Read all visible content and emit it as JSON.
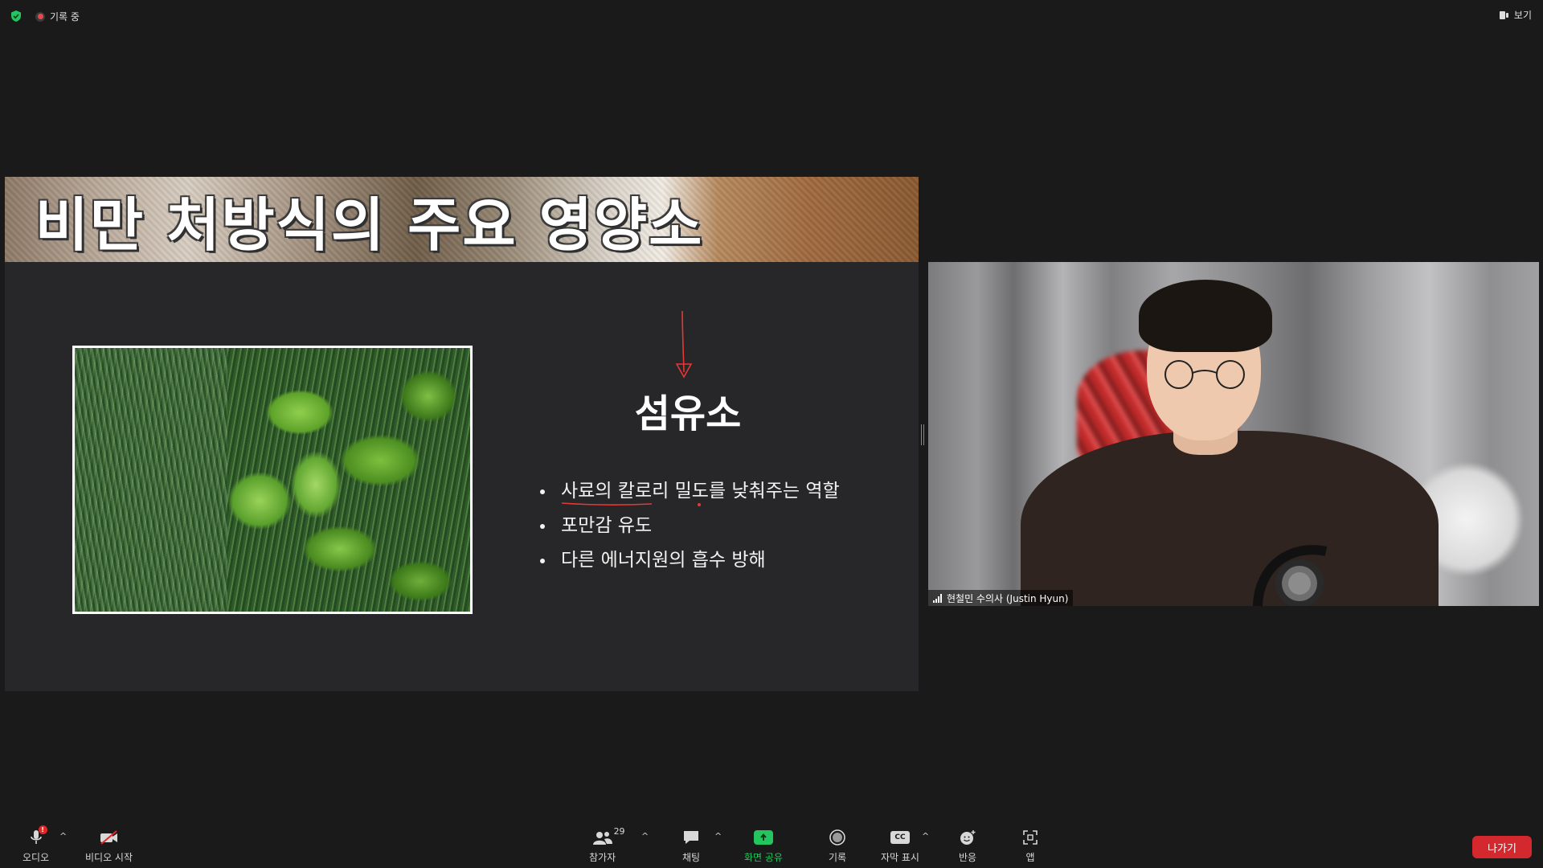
{
  "topbar": {
    "recording_label": "기록 중",
    "view_label": "보기"
  },
  "slide": {
    "title": "비만 처방식의 주요 영양소",
    "heading": "섬유소",
    "bullets": [
      "사료의 칼로리 밀도를 낮춰주는 역할",
      "포만감 유도",
      "다른 에너지원의 흡수 방해"
    ],
    "annotation_color": "#e53935"
  },
  "video": {
    "participant_name": "현철민 수의사 (Justin Hyun)"
  },
  "toolbar": {
    "audio_label": "오디오",
    "audio_badge": "!",
    "video_label": "비디오 시작",
    "participants_label": "참가자",
    "participants_count": "29",
    "chat_label": "채팅",
    "share_label": "화면 공유",
    "record_label": "기록",
    "captions_label": "자막 표시",
    "captions_icon_text": "CC",
    "reactions_label": "반응",
    "apps_label": "앱",
    "leave_label": "나가기",
    "share_color": "#22c55e",
    "leave_color": "#d4282f"
  }
}
